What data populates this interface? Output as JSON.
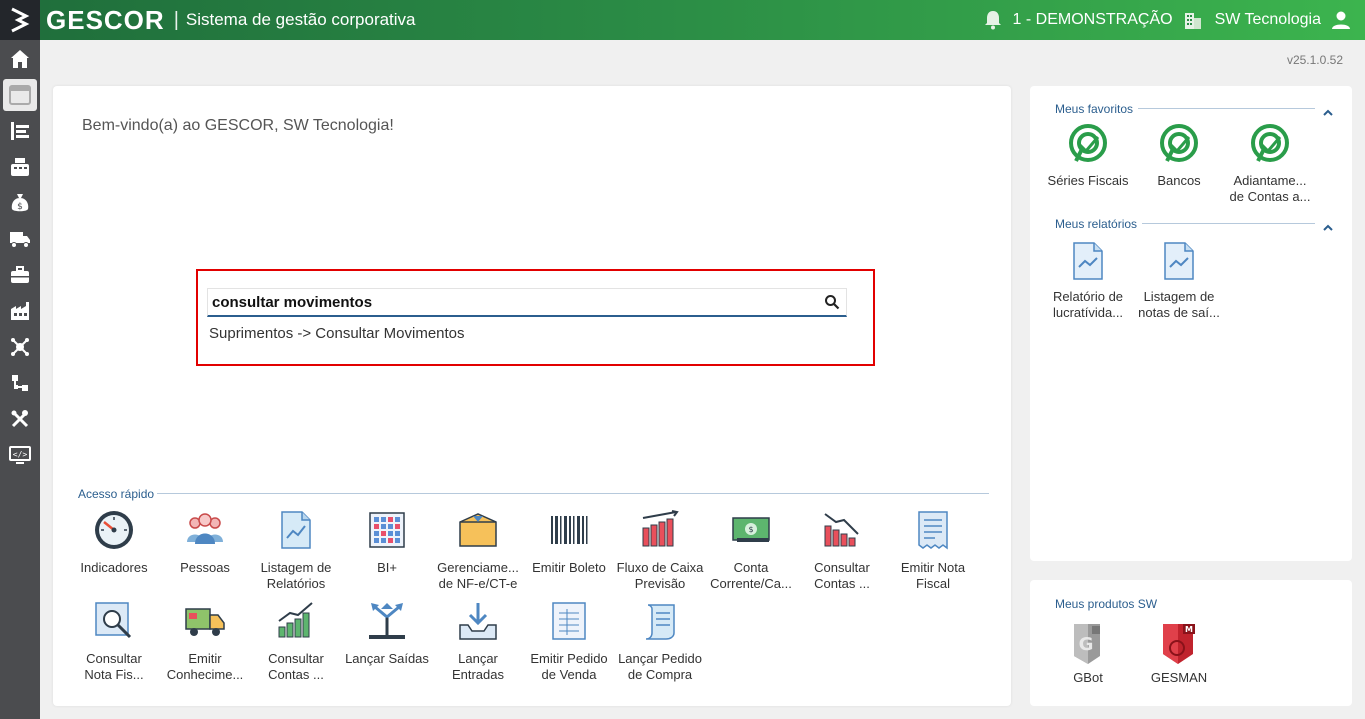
{
  "header": {
    "brand": "GESCOR",
    "separator": "|",
    "subtitle": "Sistema de gestão corporativa",
    "company": "1 - DEMONSTRAÇÃO",
    "user": "SW Tecnologia"
  },
  "version": "v25.1.0.52",
  "sidebar": {
    "items": [
      "home-icon",
      "window-icon",
      "supply-list-icon",
      "cashier-icon",
      "money-bag-icon",
      "truck-icon",
      "briefcase-icon",
      "factory-icon",
      "network-icon",
      "flow-icon",
      "tools-icon",
      "code-screen-icon"
    ]
  },
  "main": {
    "welcome": "Bem-vindo(a) ao GESCOR, SW Tecnologia!",
    "search": {
      "value": "consultar movimentos",
      "suggestion": "Suprimentos -> Consultar Movimentos"
    },
    "quick_access_title": "Acesso rápido",
    "quick_access": [
      {
        "label": "Indicadores",
        "icon": "gauge-icon"
      },
      {
        "label": "Pessoas",
        "icon": "people-icon"
      },
      {
        "label": "Listagem de\nRelatórios",
        "icon": "report-list-icon"
      },
      {
        "label": "BI+",
        "icon": "bi-grid-icon"
      },
      {
        "label": "Gerenciame...\nde NF-e/CT-e",
        "icon": "box-icon"
      },
      {
        "label": "Emitir Boleto",
        "icon": "barcode-icon"
      },
      {
        "label": "Fluxo de Caixa\nPrevisão",
        "icon": "cashflow-chart-icon"
      },
      {
        "label": "Conta\nCorrente/Ca...",
        "icon": "banknote-icon"
      },
      {
        "label": "Consultar\nContas ...",
        "icon": "down-chart-icon"
      },
      {
        "label": "Emitir Nota\nFiscal",
        "icon": "receipt-icon"
      },
      {
        "label": "Consultar\nNota Fis...",
        "icon": "magnifier-doc-icon"
      },
      {
        "label": "Emitir\nConhecime...",
        "icon": "delivery-truck-icon"
      },
      {
        "label": "Consultar\nContas ...",
        "icon": "up-chart-icon"
      },
      {
        "label": "Lançar Saídas",
        "icon": "arrows-out-icon"
      },
      {
        "label": "Lançar\nEntradas",
        "icon": "inbox-download-icon"
      },
      {
        "label": "Emitir Pedido\nde Venda",
        "icon": "sheet-icon"
      },
      {
        "label": "Lançar Pedido\nde Compra",
        "icon": "scroll-icon"
      }
    ]
  },
  "favorites": {
    "title": "Meus favoritos",
    "items": [
      {
        "label": "Séries Fiscais",
        "icon": "pin-check-icon"
      },
      {
        "label": "Bancos",
        "icon": "pin-check-icon"
      },
      {
        "label": "Adiantame...\nde Contas a...",
        "icon": "pin-check-icon"
      }
    ]
  },
  "reports": {
    "title": "Meus relatórios",
    "items": [
      {
        "label": "Relatório de\nlucratívida...",
        "icon": "report-doc-icon"
      },
      {
        "label": "Listagem de\nnotas de saí...",
        "icon": "report-doc-icon"
      }
    ]
  },
  "products": {
    "title": "Meus produtos SW",
    "items": [
      {
        "label": "GBot",
        "icon": "gbot-icon"
      },
      {
        "label": "GESMAN",
        "icon": "gesman-icon"
      }
    ]
  },
  "colors": {
    "accent_blue": "#2b5e8e",
    "highlight_red": "#e20000",
    "green_dark": "#1f6d3b",
    "green_light": "#3cb44e",
    "sidebar": "#4b4c4f"
  }
}
